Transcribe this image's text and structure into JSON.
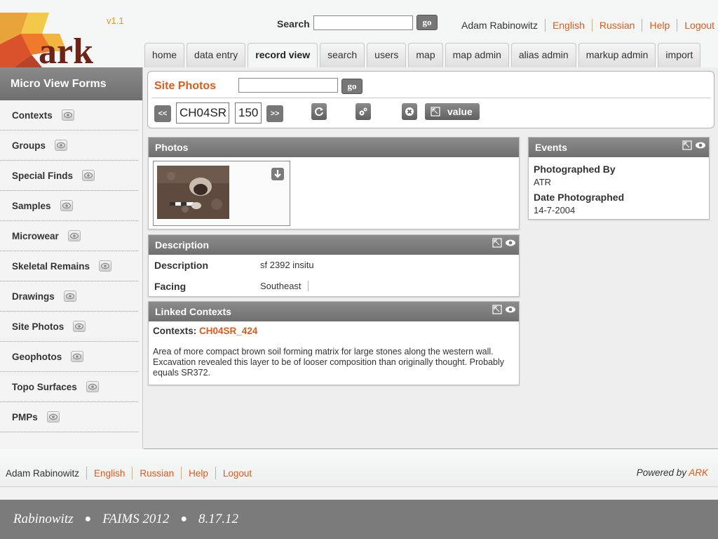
{
  "app": {
    "name": "ark",
    "version": "v1.1"
  },
  "header": {
    "search_label": "Search",
    "search_value": "",
    "go_label": "go",
    "user": "Adam Rabinowitz",
    "links": [
      "English",
      "Russian",
      "Help",
      "Logout"
    ]
  },
  "nav": {
    "tabs": [
      {
        "label": "home",
        "active": false
      },
      {
        "label": "data entry",
        "active": false
      },
      {
        "label": "record view",
        "active": true
      },
      {
        "label": "search",
        "active": false
      },
      {
        "label": "users",
        "active": false
      },
      {
        "label": "map",
        "active": false
      },
      {
        "label": "map admin",
        "active": false
      },
      {
        "label": "alias admin",
        "active": false
      },
      {
        "label": "markup admin",
        "active": false
      },
      {
        "label": "import",
        "active": false
      }
    ]
  },
  "sidebar": {
    "title": "Micro View Forms",
    "items": [
      {
        "label": "Contexts"
      },
      {
        "label": "Groups"
      },
      {
        "label": "Special Finds"
      },
      {
        "label": "Samples"
      },
      {
        "label": "Microwear"
      },
      {
        "label": "Skeletal Remains"
      },
      {
        "label": "Drawings"
      },
      {
        "label": "Site Photos"
      },
      {
        "label": "Geophotos"
      },
      {
        "label": "Topo Surfaces"
      },
      {
        "label": "PMPs"
      }
    ]
  },
  "record": {
    "title": "Site Photos",
    "input_value": "",
    "go_label": "go",
    "prev_label": "<<",
    "next_label": ">>",
    "site_code": "CH04SR",
    "number": "150",
    "value_label": "value"
  },
  "photos": {
    "title": "Photos"
  },
  "events": {
    "title": "Events",
    "photographed_by_label": "Photographed By",
    "photographed_by_value": "ATR",
    "date_label": "Date Photographed",
    "date_value": "14-7-2004"
  },
  "description": {
    "title": "Description",
    "rows": [
      {
        "key": "Description",
        "value": "sf 2392 insitu"
      },
      {
        "key": "Facing",
        "value": "Southeast"
      }
    ]
  },
  "linked_contexts": {
    "title": "Linked Contexts",
    "contexts_label": "Contexts:",
    "context_link": "CH04SR_424",
    "text": "Area of more compact brown soil forming matrix for large stones along the western wall. Excavation revealed this layer to be of looser composition than originally thought. Probably equals SR372."
  },
  "footer": {
    "user": "Adam Rabinowitz",
    "links": [
      "English",
      "Russian",
      "Help",
      "Logout"
    ],
    "powered_by": "Powered by",
    "brand": "ARK"
  },
  "slide": {
    "author": "Rabinowitz",
    "event": "FAIMS 2012",
    "date": "8.17.12"
  },
  "colors": {
    "accent": "#e05a1a",
    "panel_header": "#7a7a7a",
    "version": "#d99a2b"
  }
}
